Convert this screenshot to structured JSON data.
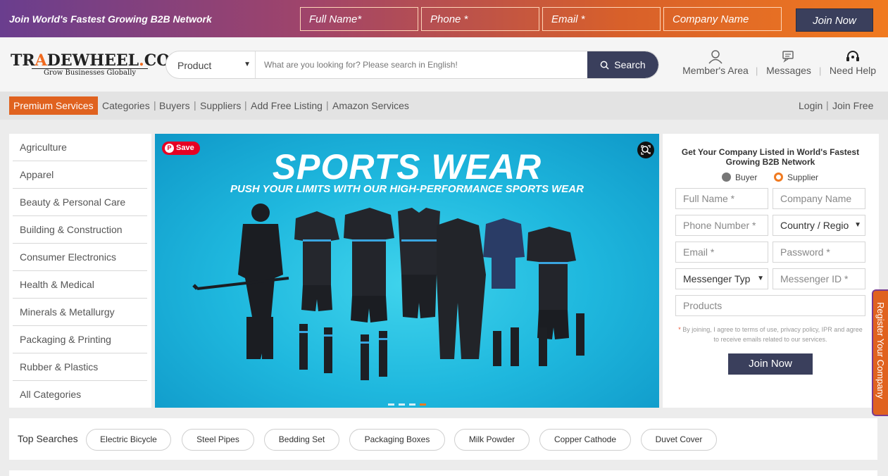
{
  "topbar": {
    "promo": "Join World's Fastest Growing B2B Network",
    "fields": [
      "Full Name*",
      "Phone *",
      "Email *",
      "Company Name"
    ],
    "join": "Join Now"
  },
  "header": {
    "logo_text": "TRADEWHEEL.COM",
    "logo_tagline": "Grow Businesses Globally",
    "search_category": "Product",
    "search_placeholder": "What are you looking for? Please search in English!",
    "search_button": "Search",
    "links": [
      "Member's Area",
      "Messages",
      "Need Help"
    ]
  },
  "nav": {
    "premium": "Premium Services",
    "items": [
      "Categories",
      "Buyers",
      "Suppliers",
      "Add Free Listing",
      "Amazon Services"
    ],
    "login": "Login",
    "join_free": "Join Free"
  },
  "categories": [
    "Agriculture",
    "Apparel",
    "Beauty & Personal Care",
    "Building & Construction",
    "Consumer Electronics",
    "Health & Medical",
    "Minerals & Metallurgy",
    "Packaging & Printing",
    "Rubber & Plastics",
    "All Categories"
  ],
  "banner": {
    "save": "Save",
    "title": "SPORTS WEAR",
    "subtitle": "PUSH YOUR LIMITS WITH OUR HIGH-PERFORMANCE SPORTS WEAR",
    "active_slide": 4,
    "slide_count": 4
  },
  "register": {
    "heading": "Get Your Company Listed in World's Fastest Growing B2B Network",
    "radio_buyer": "Buyer",
    "radio_supplier": "Supplier",
    "selected": "Supplier",
    "full_name": "Full Name *",
    "company_name": "Company Name",
    "phone": "Phone Number *",
    "country": "Country / Regio",
    "email": "Email *",
    "password": "Password *",
    "messenger_type": "Messenger Typ",
    "messenger_id": "Messenger ID *",
    "products": "Products",
    "terms": "By joining, I agree to terms of use, privacy policy, IPR and agree to receive emails related to our services.",
    "join": "Join Now"
  },
  "side_tab": "Register Your Company",
  "top_searches": {
    "label": "Top Searches",
    "items": [
      "Electric Bicycle",
      "Steel Pipes",
      "Bedding Set",
      "Packaging Boxes",
      "Milk Powder",
      "Copper Cathode",
      "Duvet Cover"
    ]
  },
  "colors": {
    "accent_orange": "#e0621f",
    "navy": "#3a3f5c",
    "pinterest_red": "#e60023"
  }
}
